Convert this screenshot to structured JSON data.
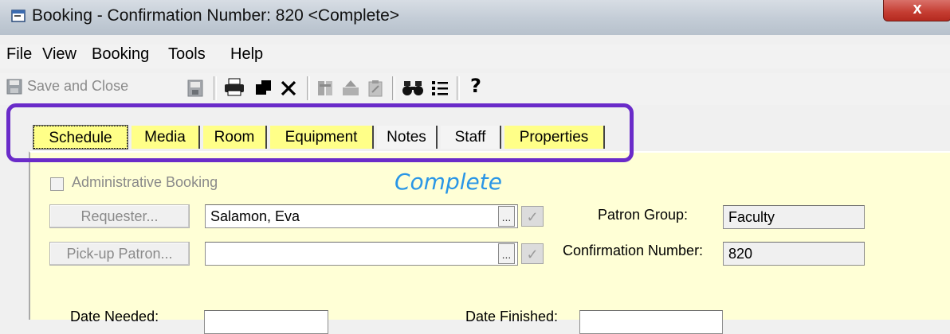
{
  "window": {
    "title": "Booking - Confirmation Number:  820  <Complete>",
    "close_label": "x"
  },
  "menu": {
    "items": [
      "File",
      "View",
      "Booking",
      "Tools",
      "Help"
    ]
  },
  "toolbar": {
    "save_close_label": "Save and Close",
    "icons": [
      "save-icon",
      "print-icon",
      "copy-icon",
      "delete-icon",
      "copy-booking-icon",
      "move-icon",
      "clipboard-icon",
      "find-icon",
      "list-icon",
      "help-icon"
    ]
  },
  "tabs": [
    {
      "label": "Schedule",
      "color": "#ffff88",
      "active": true
    },
    {
      "label": "Media",
      "color": "#ffff88",
      "active": false
    },
    {
      "label": "Room",
      "color": "#ffff88",
      "active": false
    },
    {
      "label": "Equipment",
      "color": "#ffff88",
      "active": false
    },
    {
      "label": "Notes",
      "color": "#f4f4f4",
      "active": false
    },
    {
      "label": "Staff",
      "color": "#f4f4f4",
      "active": false
    },
    {
      "label": "Properties",
      "color": "#ffff88",
      "active": false
    }
  ],
  "booking": {
    "administrative_label": "Administrative Booking",
    "administrative_checked": false,
    "status": "Complete",
    "requester_button": "Requester...",
    "requester_value": "Salamon, Eva",
    "pickup_button": "Pick-up Patron...",
    "pickup_value": "",
    "patron_group_label": "Patron Group:",
    "patron_group_value": "Faculty",
    "confirmation_label": "Confirmation Number:",
    "confirmation_value": "820",
    "date_needed_label": "Date Needed:",
    "date_finished_label": "Date Finished:",
    "lookup_label": "..."
  },
  "colors": {
    "highlight": "#6a2bc9",
    "status_blue": "#2a96e6",
    "tab_yellow": "#ffff88",
    "panel_bg": "#ffffd6"
  }
}
